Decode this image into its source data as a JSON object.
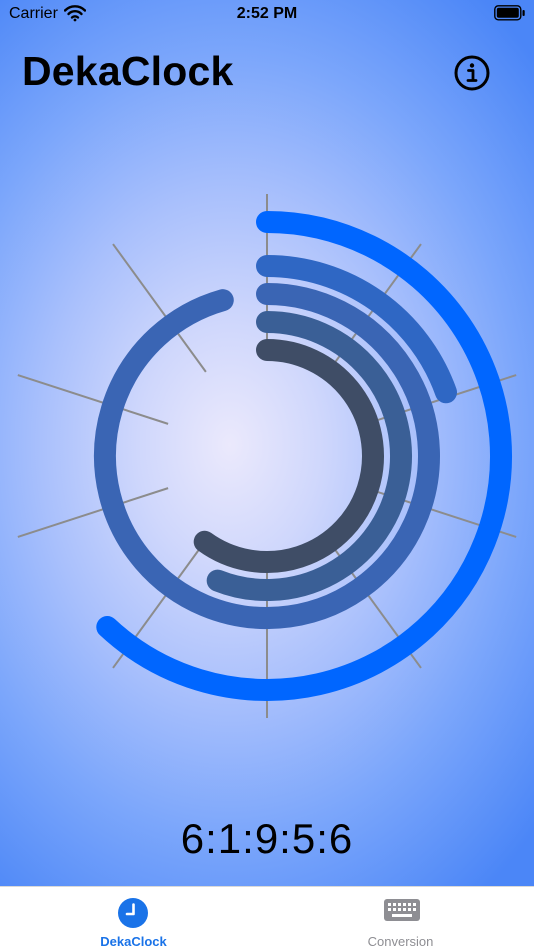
{
  "status_bar": {
    "carrier": "Carrier",
    "time": "2:52 PM"
  },
  "header": {
    "title": "DekaClock"
  },
  "clock": {
    "readout": "6:1:9:5:6",
    "rings": [
      {
        "unit_index": 1,
        "value": 6,
        "color": "#0066ff"
      },
      {
        "unit_index": 2,
        "value": 1,
        "color": "#2f67c4"
      },
      {
        "unit_index": 3,
        "value": 9,
        "color": "#3a65b4"
      },
      {
        "unit_index": 4,
        "value": 5,
        "color": "#3a5f96"
      },
      {
        "unit_index": 5,
        "value": 6,
        "color": "#3f4d66"
      }
    ]
  },
  "tab_bar": {
    "tabs": [
      {
        "label": "DekaClock",
        "icon": "clock-icon",
        "selected": true
      },
      {
        "label": "Conversion",
        "icon": "keyboard-icon",
        "selected": false
      }
    ]
  },
  "colors": {
    "accent": "#1a73e8",
    "tick": "#8c8c8c",
    "inactive_tab": "#8e8e93"
  }
}
